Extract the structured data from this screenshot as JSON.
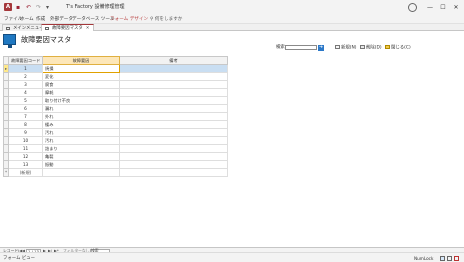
{
  "titlebar": {
    "app_letter": "A",
    "qat_icons": [
      "save-icon",
      "undo-icon",
      "redo-icon",
      "customize-icon"
    ],
    "title": "T's Factory 設備修理管理",
    "window_controls": {
      "minimize": "—",
      "maximize": "☐",
      "close": "✕"
    }
  },
  "ribbon": {
    "tabs": [
      "ファイル",
      "ホーム",
      "作成",
      "外部データ",
      "データベース ツール",
      "フォーム デザイン"
    ],
    "context_tab": "フォーム デザイン",
    "search_label": "何をしますか"
  },
  "doc_tabs": [
    {
      "label": "メインメニュー",
      "active": false
    },
    {
      "label": "故障要因マスタ",
      "active": true
    }
  ],
  "form": {
    "title": "故障要因マスタ",
    "search_label": "検索",
    "search_value": "",
    "search_go": "➔",
    "buttons": [
      {
        "label": "新規(N)",
        "icon": "new-record-icon"
      },
      {
        "label": "削除(D)",
        "icon": "delete-icon"
      },
      {
        "label": "閉じる(C)",
        "icon": "close-form-icon"
      }
    ],
    "columns": [
      "故障要因コード",
      "故障要因",
      "備考"
    ],
    "rows": [
      {
        "code": "1",
        "name": "焼損",
        "note": ""
      },
      {
        "code": "2",
        "name": "変化",
        "note": ""
      },
      {
        "code": "3",
        "name": "腐食",
        "note": ""
      },
      {
        "code": "4",
        "name": "摩耗",
        "note": ""
      },
      {
        "code": "5",
        "name": "取り付け不良",
        "note": ""
      },
      {
        "code": "6",
        "name": "漏れ",
        "note": ""
      },
      {
        "code": "7",
        "name": "外れ",
        "note": ""
      },
      {
        "code": "8",
        "name": "緩み",
        "note": ""
      },
      {
        "code": "9",
        "name": "汚れ",
        "note": ""
      },
      {
        "code": "10",
        "name": "汚れ",
        "note": ""
      },
      {
        "code": "11",
        "name": "詰まり",
        "note": ""
      },
      {
        "code": "12",
        "name": "亀裂",
        "note": ""
      },
      {
        "code": "13",
        "name": "振動",
        "note": ""
      }
    ],
    "new_row_label": "(新規)",
    "current_row_index": 0
  },
  "record_nav": {
    "label": "レコード:",
    "count": "1 / 13",
    "first": "|◀",
    "prev": "◀",
    "next": "▶",
    "last": "▶|",
    "new": "▶*",
    "filter_label": "フィルターなし",
    "search_label": "検索"
  },
  "statusbar": {
    "left": "フォーム ビュー",
    "numlock": "NumLock"
  },
  "colors": {
    "accent": "#a4373a",
    "selection": "#c9def2",
    "current_marker": "#ffe98a",
    "icon_blue": "#1f78c1"
  }
}
